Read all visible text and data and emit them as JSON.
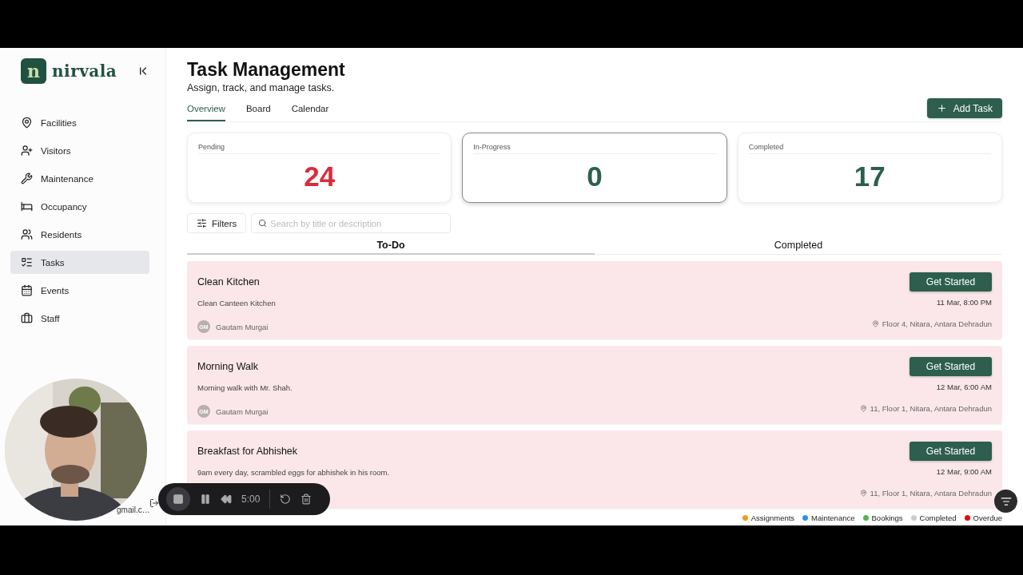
{
  "sidebar": {
    "brand": {
      "mark": "n",
      "name": "nirvala"
    },
    "items": [
      {
        "label": "Facilities",
        "selected": false
      },
      {
        "label": "Visitors",
        "selected": false
      },
      {
        "label": "Maintenance",
        "selected": false
      },
      {
        "label": "Occupancy",
        "selected": false
      },
      {
        "label": "Residents",
        "selected": false
      },
      {
        "label": "Tasks",
        "selected": true
      },
      {
        "label": "Events",
        "selected": false
      },
      {
        "label": "Staff",
        "selected": false
      }
    ],
    "user_email": "gmail.c…"
  },
  "header": {
    "title": "Task Management",
    "subtitle": "Assign, track, and manage tasks."
  },
  "tabs": [
    {
      "label": "Overview",
      "selected": true
    },
    {
      "label": "Board",
      "selected": false
    },
    {
      "label": "Calendar",
      "selected": false
    }
  ],
  "add_button": "Add Task",
  "stats": [
    {
      "label": "Pending",
      "value": "24",
      "color": "#d92d3c",
      "selected": false
    },
    {
      "label": "In-Progress",
      "value": "0",
      "color": "#2d5e4e",
      "selected": true
    },
    {
      "label": "Completed",
      "value": "17",
      "color": "#2d5e4e",
      "selected": false
    }
  ],
  "filters_button": "Filters",
  "search": {
    "placeholder": "Search by title or description"
  },
  "list_tabs": [
    {
      "label": "To-Do",
      "selected": true
    },
    {
      "label": "Completed",
      "selected": false
    }
  ],
  "tasks": [
    {
      "title": "Clean Kitchen",
      "description": "Clean Canteen Kitchen",
      "assignee_initials": "GM",
      "assignee": "Gautam Murgai",
      "action": "Get Started",
      "due": "11 Mar, 8:00 PM",
      "location": "Floor 4, Nitara, Antara Dehradun"
    },
    {
      "title": "Morning Walk",
      "description": "Morning walk with Mr. Shah.",
      "assignee_initials": "GM",
      "assignee": "Gautam Murgai",
      "action": "Get Started",
      "due": "12 Mar, 6:00 AM",
      "location": "11, Floor 1, Nitara, Antara Dehradun"
    },
    {
      "title": "Breakfast for Abhishek",
      "description": "9am every day, scrambled eggs for abhishek in his room.",
      "action": "Get Started",
      "due": "12 Mar, 9:00 AM",
      "location": "11, Floor 1, Nitara, Antara Dehradun"
    }
  ],
  "legend": [
    {
      "label": "Assignments",
      "color": "#f29a1f"
    },
    {
      "label": "Maintenance",
      "color": "#2f8ff0"
    },
    {
      "label": "Bookings",
      "color": "#4cb850"
    },
    {
      "label": "Completed",
      "color": "#cccccc"
    },
    {
      "label": "Overdue",
      "color": "#e01010"
    }
  ],
  "recorder": {
    "time": "5:00"
  }
}
